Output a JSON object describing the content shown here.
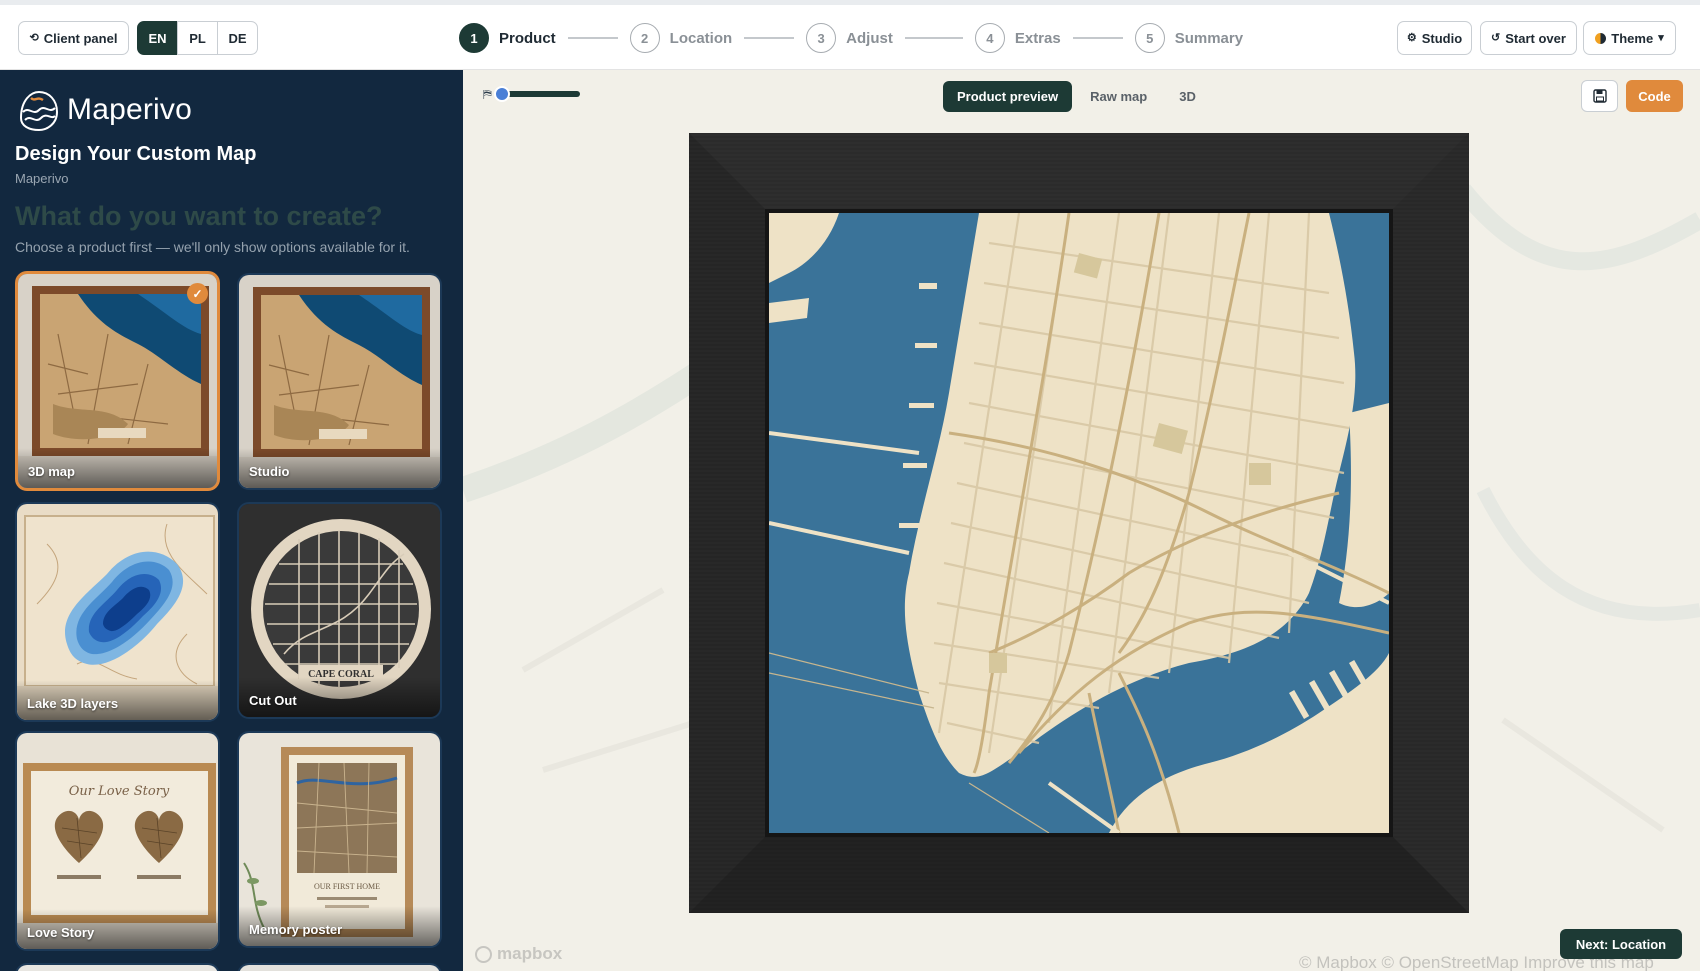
{
  "topbar": {
    "client_panel_label": "Client panel",
    "languages": [
      "EN",
      "PL",
      "DE"
    ],
    "active_language": "EN",
    "steps": [
      {
        "num": "1",
        "label": "Product"
      },
      {
        "num": "2",
        "label": "Location"
      },
      {
        "num": "3",
        "label": "Adjust"
      },
      {
        "num": "4",
        "label": "Extras"
      },
      {
        "num": "5",
        "label": "Summary"
      }
    ],
    "studio_label": "Studio",
    "start_over_label": "Start over",
    "theme_label": "Theme"
  },
  "sidebar": {
    "brand": "Maperivo",
    "title": "Design Your Custom Map",
    "subtitle": "Maperivo",
    "question": "What do you want to create?",
    "description": "Choose a product first — we'll only show options available for it.",
    "products": [
      {
        "label": "3D map",
        "selected": true
      },
      {
        "label": "Studio",
        "selected": false
      },
      {
        "label": "Lake 3D layers",
        "selected": false
      },
      {
        "label": "Cut Out",
        "selected": false
      },
      {
        "label": "Love Story",
        "selected": false
      },
      {
        "label": "Memory poster",
        "selected": false
      }
    ],
    "cutout_caption": "CAPE CORAL",
    "lovestory_caption": "Our Love Story",
    "memory_caption": "OUR FIRST HOME"
  },
  "main": {
    "view_tabs": [
      "Product preview",
      "Raw map",
      "3D"
    ],
    "active_view": "Product preview",
    "code_label": "Code",
    "next_label": "Next: Location",
    "mapbox_logo": "mapbox",
    "attribution": "© Mapbox © OpenStreetMap  Improve this map"
  },
  "colors": {
    "accent": "#e08a3c",
    "primary": "#1d3a35",
    "sidebar_bg": "#12283f",
    "water": "#3a7399",
    "land": "#eee2c6",
    "frame": "#2b2b2b"
  }
}
